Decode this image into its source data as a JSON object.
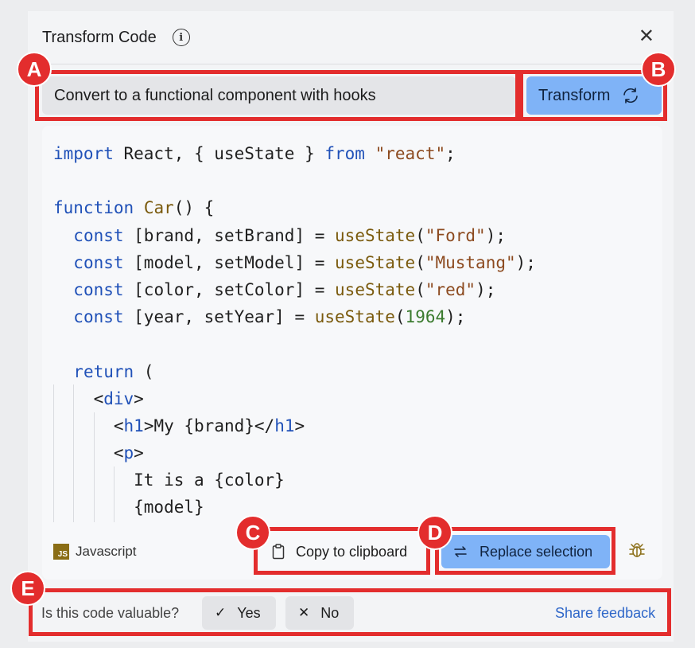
{
  "header": {
    "title": "Transform Code"
  },
  "prompt": {
    "value": "Convert to a functional component with hooks"
  },
  "transform_button": {
    "label": "Transform"
  },
  "code_lines": [
    [
      [
        "import",
        "kw"
      ],
      [
        " React, { useState } ",
        ""
      ],
      [
        "from",
        "kw"
      ],
      [
        " ",
        ""
      ],
      [
        "\"react\"",
        "str"
      ],
      [
        ";",
        ""
      ]
    ],
    [],
    [
      [
        "function",
        "kw"
      ],
      [
        " ",
        ""
      ],
      [
        "Car",
        "fn"
      ],
      [
        "() {",
        ""
      ]
    ],
    [
      [
        "  ",
        ""
      ],
      [
        "const",
        "kw"
      ],
      [
        " [brand, setBrand] = ",
        ""
      ],
      [
        "useState",
        "fn"
      ],
      [
        "(",
        ""
      ],
      [
        "\"Ford\"",
        "str"
      ],
      [
        ");",
        ""
      ]
    ],
    [
      [
        "  ",
        ""
      ],
      [
        "const",
        "kw"
      ],
      [
        " [model, setModel] = ",
        ""
      ],
      [
        "useState",
        "fn"
      ],
      [
        "(",
        ""
      ],
      [
        "\"Mustang\"",
        "str"
      ],
      [
        ");",
        ""
      ]
    ],
    [
      [
        "  ",
        ""
      ],
      [
        "const",
        "kw"
      ],
      [
        " [color, setColor] = ",
        ""
      ],
      [
        "useState",
        "fn"
      ],
      [
        "(",
        ""
      ],
      [
        "\"red\"",
        "str"
      ],
      [
        ");",
        ""
      ]
    ],
    [
      [
        "  ",
        ""
      ],
      [
        "const",
        "kw"
      ],
      [
        " [year, setYear] = ",
        ""
      ],
      [
        "useState",
        "fn"
      ],
      [
        "(",
        ""
      ],
      [
        "1964",
        "num"
      ],
      [
        ");",
        ""
      ]
    ],
    [],
    [
      [
        "  ",
        ""
      ],
      [
        "return",
        "kw"
      ],
      [
        " (",
        ""
      ]
    ],
    [
      [
        "    <",
        ""
      ],
      [
        "div",
        "tag"
      ],
      [
        ">",
        ""
      ]
    ],
    [
      [
        "      <",
        ""
      ],
      [
        "h1",
        "tag"
      ],
      [
        ">My {brand}</",
        ""
      ],
      [
        "h1",
        "tag"
      ],
      [
        ">",
        ""
      ]
    ],
    [
      [
        "      <",
        ""
      ],
      [
        "p",
        "tag"
      ],
      [
        ">",
        ""
      ]
    ],
    [
      [
        "        It is a {color}",
        ""
      ]
    ],
    [
      [
        "        {model}",
        ""
      ]
    ]
  ],
  "footer": {
    "language": "Javascript",
    "language_badge": "JS",
    "copy_label": "Copy to clipboard",
    "replace_label": "Replace selection"
  },
  "feedback": {
    "question": "Is this code valuable?",
    "yes_label": "Yes",
    "no_label": "No",
    "share_label": "Share feedback"
  },
  "markers": {
    "a": "A",
    "b": "B",
    "c": "C",
    "d": "D",
    "e": "E"
  },
  "colors": {
    "highlight": "#e32d2d",
    "accent": "#7fb3f7",
    "link": "#2f67c9"
  }
}
